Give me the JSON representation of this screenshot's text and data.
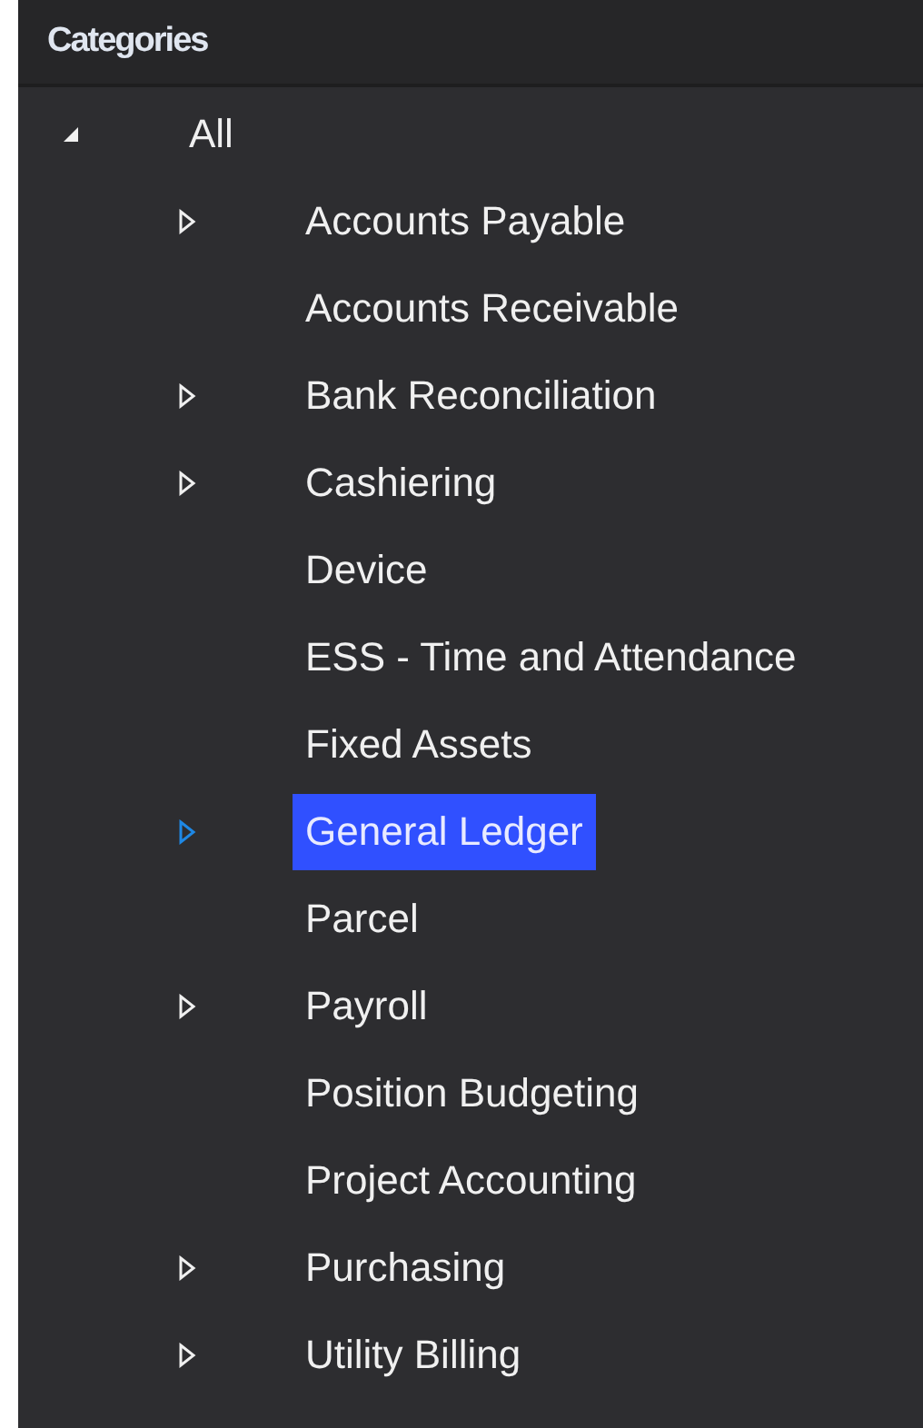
{
  "header": {
    "title": "Categories"
  },
  "tree": [
    {
      "label": "All",
      "expandable": true,
      "expanded": true,
      "selected": false,
      "children": [
        {
          "label": "Accounts Payable",
          "expandable": true,
          "expanded": false,
          "selected": false
        },
        {
          "label": "Accounts Receivable",
          "expandable": false,
          "selected": false
        },
        {
          "label": "Bank Reconciliation",
          "expandable": true,
          "expanded": false,
          "selected": false
        },
        {
          "label": "Cashiering",
          "expandable": true,
          "expanded": false,
          "selected": false
        },
        {
          "label": "Device",
          "expandable": false,
          "selected": false
        },
        {
          "label": "ESS - Time and Attendance",
          "expandable": false,
          "selected": false
        },
        {
          "label": "Fixed Assets",
          "expandable": false,
          "selected": false
        },
        {
          "label": "General Ledger",
          "expandable": true,
          "expanded": false,
          "selected": true
        },
        {
          "label": "Parcel",
          "expandable": false,
          "selected": false
        },
        {
          "label": "Payroll",
          "expandable": true,
          "expanded": false,
          "selected": false
        },
        {
          "label": "Position Budgeting",
          "expandable": false,
          "selected": false
        },
        {
          "label": "Project Accounting",
          "expandable": false,
          "selected": false
        },
        {
          "label": "Purchasing",
          "expandable": true,
          "expanded": false,
          "selected": false
        },
        {
          "label": "Utility Billing",
          "expandable": true,
          "expanded": false,
          "selected": false
        }
      ]
    }
  ]
}
